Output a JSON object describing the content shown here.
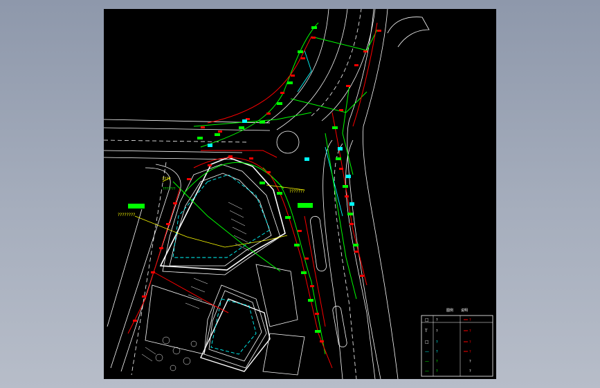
{
  "colors": {
    "background": "#000000",
    "frame": "#8e98ab",
    "road_line": "#ffffff",
    "design_line": "#ff0000",
    "existing_line": "#00ff00",
    "utility_line": "#00ffff",
    "leader_line": "#ffff00"
  },
  "labels": {
    "tag_1": "????",
    "tag_2": "????????",
    "tag_3": "???????",
    "tag_4": "???????",
    "green_box_1": "",
    "green_box_2": ""
  },
  "legend": {
    "header_a": "图例",
    "header_b": "说明",
    "rows": [
      {
        "symbol": "□",
        "left": "?",
        "right": "?"
      },
      {
        "symbol": "T",
        "left": "?",
        "right": "?"
      },
      {
        "symbol": "□",
        "left": "?",
        "right": "?"
      },
      {
        "symbol": "—",
        "left": "?",
        "right": "?"
      },
      {
        "symbol": "—",
        "left": "?",
        "right": "?"
      },
      {
        "symbol": "—",
        "left": "?",
        "right": "?"
      }
    ]
  }
}
